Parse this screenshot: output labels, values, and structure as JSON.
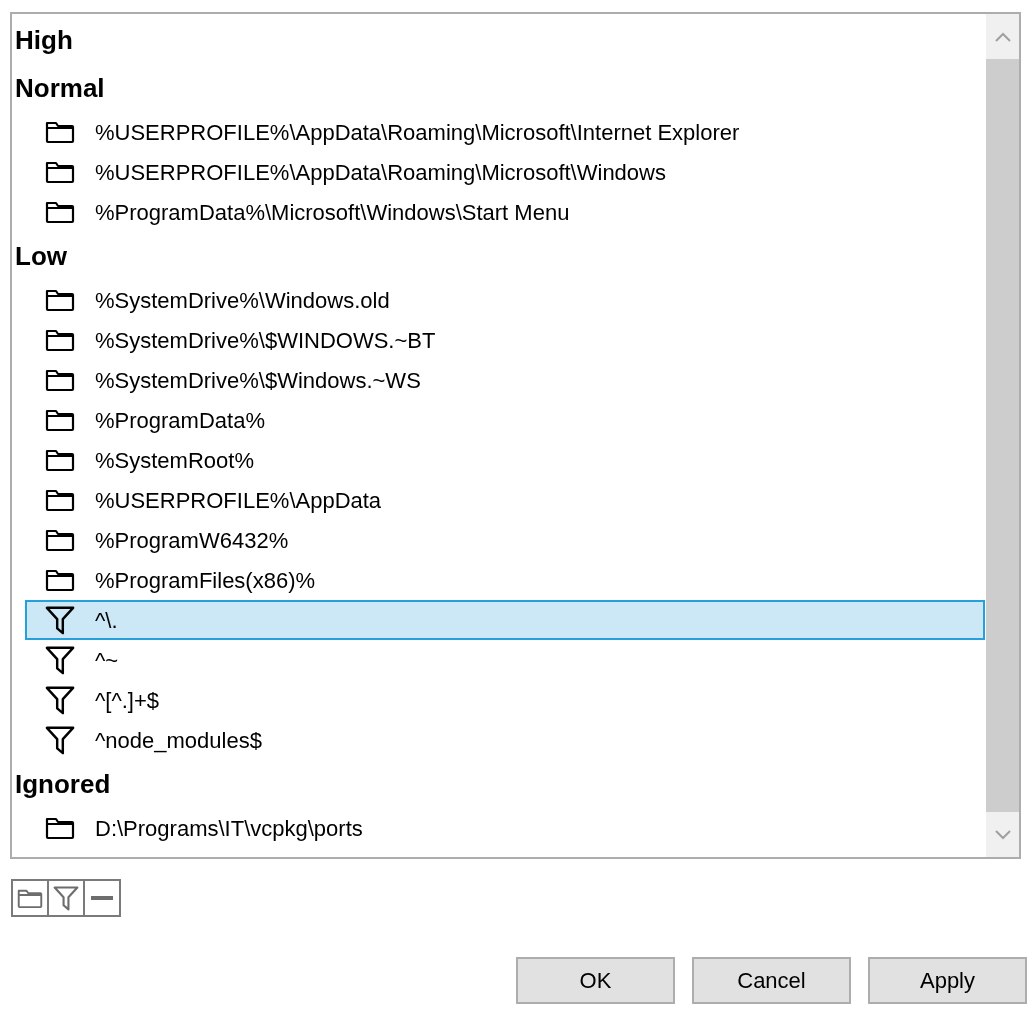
{
  "groups": [
    {
      "title": "High"
    },
    {
      "title": "Normal",
      "items": [
        {
          "kind": "folder",
          "text": "%USERPROFILE%\\AppData\\Roaming\\Microsoft\\Internet Explorer",
          "selected": false
        },
        {
          "kind": "folder",
          "text": "%USERPROFILE%\\AppData\\Roaming\\Microsoft\\Windows",
          "selected": false
        },
        {
          "kind": "folder",
          "text": "%ProgramData%\\Microsoft\\Windows\\Start Menu",
          "selected": false
        }
      ]
    },
    {
      "title": "Low",
      "items": [
        {
          "kind": "folder",
          "text": "%SystemDrive%\\Windows.old",
          "selected": false
        },
        {
          "kind": "folder",
          "text": "%SystemDrive%\\$WINDOWS.~BT",
          "selected": false
        },
        {
          "kind": "folder",
          "text": "%SystemDrive%\\$Windows.~WS",
          "selected": false
        },
        {
          "kind": "folder",
          "text": "%ProgramData%",
          "selected": false
        },
        {
          "kind": "folder",
          "text": "%SystemRoot%",
          "selected": false
        },
        {
          "kind": "folder",
          "text": "%USERPROFILE%\\AppData",
          "selected": false
        },
        {
          "kind": "folder",
          "text": "%ProgramW6432%",
          "selected": false
        },
        {
          "kind": "folder",
          "text": "%ProgramFiles(x86)%",
          "selected": false
        },
        {
          "kind": "filter",
          "text": "^\\.",
          "selected": true
        },
        {
          "kind": "filter",
          "text": "^~",
          "selected": false
        },
        {
          "kind": "filter",
          "text": "^[^.]+$",
          "selected": false
        },
        {
          "kind": "filter",
          "text": "^node_modules$",
          "selected": false
        }
      ]
    },
    {
      "title": "Ignored",
      "items": [
        {
          "kind": "folder",
          "text": "D:\\Programs\\IT\\vcpkg\\ports",
          "selected": false
        }
      ]
    }
  ],
  "toolbar": [
    {
      "kind": "folder"
    },
    {
      "kind": "filter"
    },
    {
      "kind": "remove"
    }
  ],
  "buttons": [
    "OK",
    "Cancel",
    "Apply"
  ]
}
